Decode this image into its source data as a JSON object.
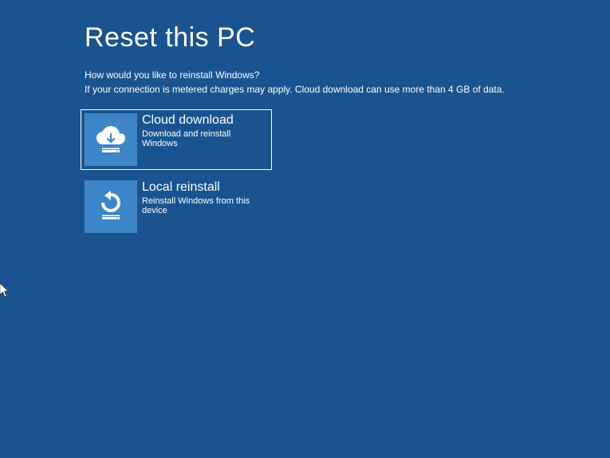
{
  "title": "Reset this PC",
  "question": "How would you like to reinstall Windows?",
  "note": "If your connection is metered charges may apply. Cloud download can use more than 4 GB of data.",
  "options": {
    "cloud": {
      "title": "Cloud download",
      "desc": "Download and reinstall Windows"
    },
    "local": {
      "title": "Local reinstall",
      "desc": "Reinstall Windows from this device"
    }
  }
}
